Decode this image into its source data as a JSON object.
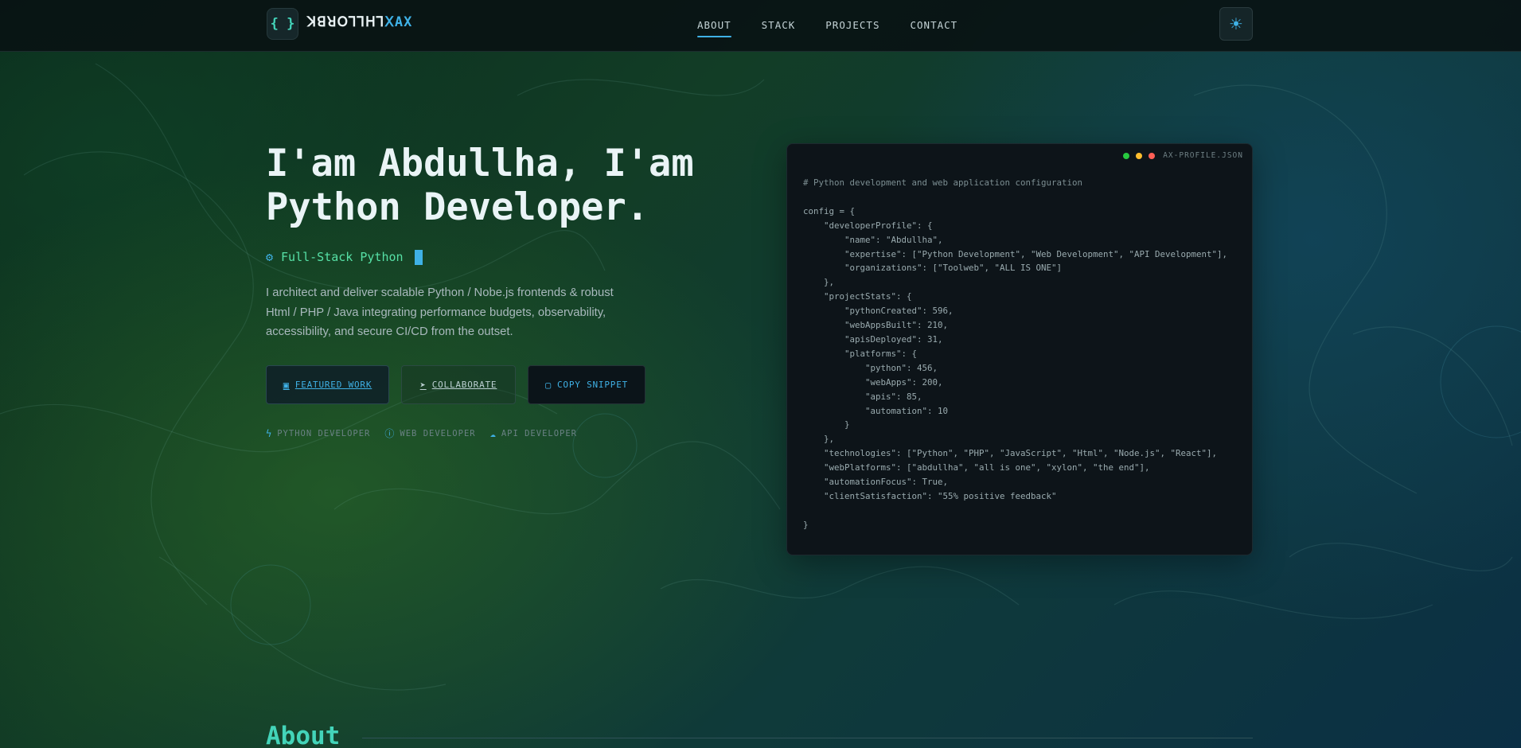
{
  "header": {
    "logo_icon": "{ }",
    "logo_name": "ꓘꓭꓤꓳꓶꓶꓧꓶ",
    "logo_suffix": "ꓫAX",
    "nav": [
      {
        "label": "ABOUT",
        "active": true
      },
      {
        "label": "STACK",
        "active": false
      },
      {
        "label": "PROJECTS",
        "active": false
      },
      {
        "label": "CONTACT",
        "active": false
      }
    ],
    "theme_toggle_icon": "sun-icon"
  },
  "hero": {
    "title_line1": "I'am Abdullha, I'am",
    "title_line2": "Python Developer.",
    "subtitle": "Full-Stack Python",
    "description": "I architect and deliver scalable Python / Nobe.js frontends & robust Html / PHP / Java integrating performance budgets, observability, accessibility, and secure CI/CD from the outset.",
    "buttons": {
      "featured": "FEATURED WORK",
      "collaborate": "COLLABORATE",
      "copy": "COPY SNIPPET"
    },
    "tags": [
      "PYTHON DEVELOPER",
      "WEB DEVELOPER",
      "API DEVELOPER"
    ]
  },
  "code_card": {
    "filename": "AX-PROFILE.JSON",
    "comment": "# Python development and web application configuration",
    "body": "config = {\n    \"developerProfile\": {\n        \"name\": \"Abdullha\",\n        \"expertise\": [\"Python Development\", \"Web Development\", \"API Development\"],\n        \"organizations\": [\"Toolweb\", \"ALL IS ONE\"]\n    },\n    \"projectStats\": {\n        \"pythonCreated\": 596,\n        \"webAppsBuilt\": 210,\n        \"apisDeployed\": 31,\n        \"platforms\": {\n            \"python\": 456,\n            \"webApps\": 200,\n            \"apis\": 85,\n            \"automation\": 10\n        }\n    },\n    \"technologies\": [\"Python\", \"PHP\", \"JavaScript\", \"Html\", \"Node.js\", \"React\"],\n    \"webPlatforms\": [\"abdullha\", \"all is one\", \"xylon\", \"the end\"],\n    \"automationFocus\": True,\n    \"clientSatisfaction\": \"55% positive feedback\"\n\n}",
    "dot_colors": [
      "#27c93f",
      "#ffbd2e",
      "#ff5f56"
    ]
  },
  "about": {
    "title": "About"
  },
  "colors": {
    "accent": "#3fb1e6",
    "teal": "#43d4b9",
    "green": "#56e0a6"
  }
}
